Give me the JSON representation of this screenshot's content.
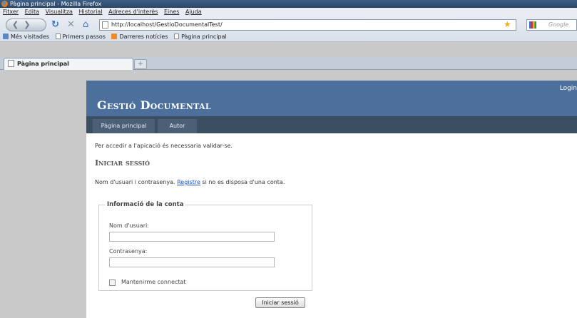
{
  "window": {
    "title": "Pàgina principal - Mozilla Firefox"
  },
  "menubar": [
    "Fitxer",
    "Edita",
    "Visualitza",
    "Historial",
    "Adreces d'interès",
    "Eines",
    "Ajuda"
  ],
  "nav": {
    "url": "http://localhost/GestioDocumentalTest/",
    "search_placeholder": "Google"
  },
  "bookmarks": [
    "Més visitades",
    "Primers passos",
    "Darreres notícies",
    "Pàgina principal"
  ],
  "tabs": [
    {
      "label": "Pàgina principal"
    }
  ],
  "site": {
    "title": "Gestió Documental",
    "login": "Login",
    "menu": [
      "Pàgina principal",
      "Autor"
    ]
  },
  "content": {
    "intro": "Per accedir a l'apicació és necessaria validar-se.",
    "heading": "Iniciar sessió",
    "hint_before": "Nom d'usuari i contrasenya.",
    "hint_link": "Registre",
    "hint_after": "si no es disposa d'una conta.",
    "fieldset_legend": "Informació de la conta",
    "username_label": "Nom d'usuari:",
    "password_label": "Contrasenya:",
    "remember_label": "Mantenirme connectat",
    "submit_label": "Iniciar sessió"
  }
}
